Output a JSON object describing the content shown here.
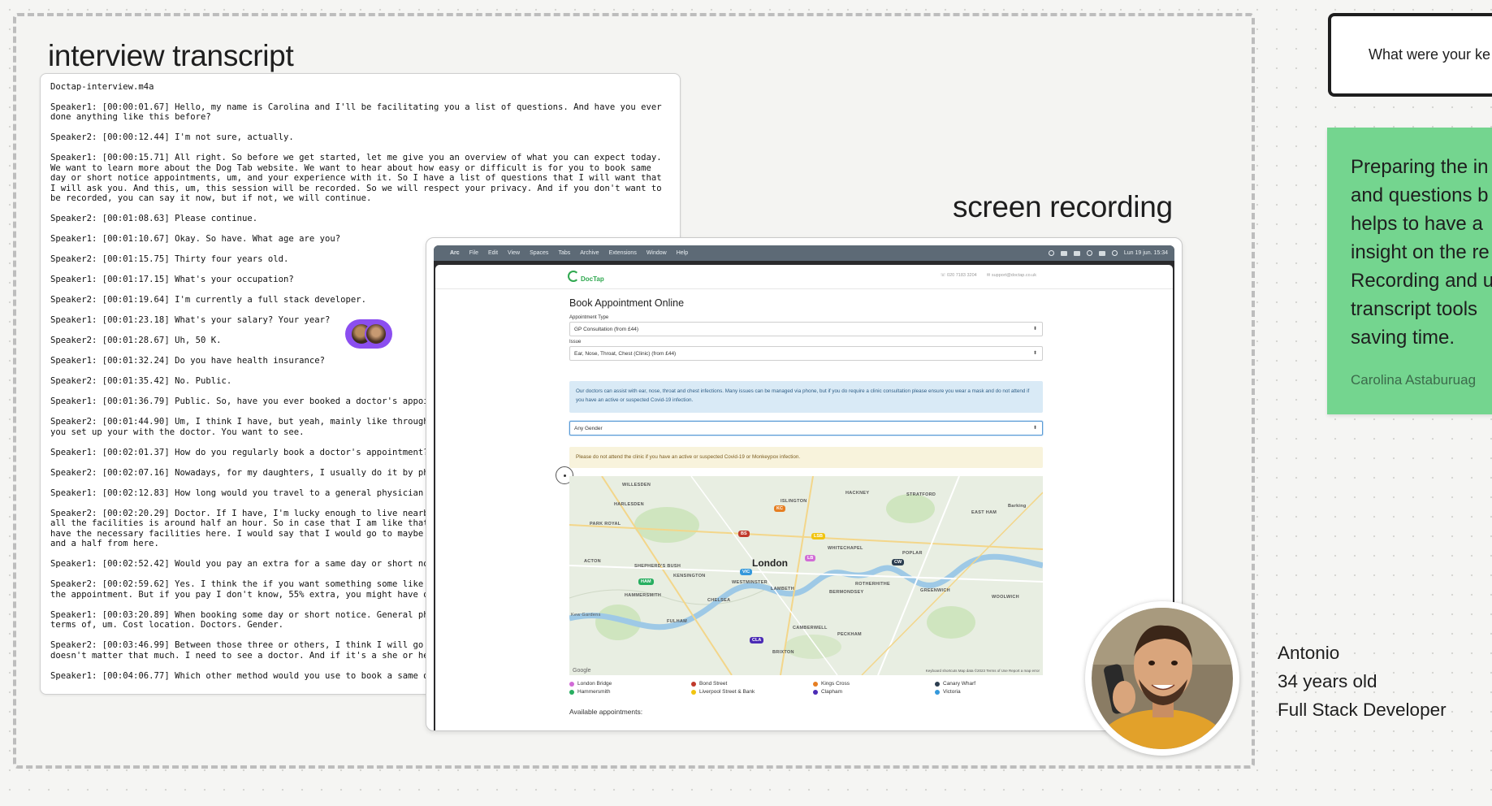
{
  "canvas": {
    "transcript_heading": "interview transcript",
    "recording_heading": "screen recording"
  },
  "transcript": {
    "filename": "Doctap-interview.m4a",
    "lines": [
      "Speaker1: [00:00:01.67] Hello, my name is Carolina and I'll be facilitating you a list of questions. And have you ever done anything like this before?",
      "Speaker2: [00:00:12.44] I'm not sure, actually.",
      "Speaker1: [00:00:15.71] All right. So before we get started, let me give you an overview of what you can expect today. We want to learn more about the Dog Tab website. We want to hear about how easy or difficult is for you to book same day or short notice appointments, um, and your experience with it. So I have a list of questions that I will want that I will ask you. And this, um, this session will be recorded. So we will respect your privacy. And if you don't want to be recorded, you can say it now, but if not, we will continue.",
      "Speaker2: [00:01:08.63] Please continue.",
      "Speaker1: [00:01:10.67] Okay. So have. What age are you?",
      "Speaker2: [00:01:15.75] Thirty four years old.",
      "Speaker1: [00:01:17.15] What's your occupation?",
      "Speaker2: [00:01:19.64] I'm currently a full stack developer.",
      "Speaker1: [00:01:23.18] What's your salary? Your year?",
      "Speaker2: [00:01:28.67] Uh, 50 K.",
      "Speaker1: [00:01:32.24] Do you have health insurance?",
      "Speaker2: [00:01:35.42] No. Public.",
      "Speaker1: [00:01:36.79] Public. So, have you ever booked a doctor's appoi",
      "Speaker2: [00:01:44.90] Um, I think I have, but yeah, mainly like through\nyou set up your with the doctor. You want to see.",
      "Speaker1: [00:02:01.37] How do you regularly book a doctor's appointment?",
      "Speaker2: [00:02:07.16] Nowadays, for my daughters, I usually do it by ph",
      "Speaker1: [00:02:12.83] How long would you travel to a general physician'",
      "Speaker2: [00:02:20.29] Doctor. If I have, I'm lucky enough to live nearb\nall the facilities is around half an hour. So in case that I am like that\nhave the necessary facilities here. I would say that I would go to maybe\nand a half from here.",
      "Speaker1: [00:02:52.42] Would you pay an extra for a same day or short no",
      "Speaker2: [00:02:59.62] Yes. I think the if you want something some like\nthe appointment. But if you pay I don't know, 55% extra, you might have o",
      "Speaker1: [00:03:20.89] When booking some day or short notice. General ph\nterms of, um. Cost location. Doctors. Gender.",
      "Speaker2: [00:03:46.99] Between those three or others, I think I will go\ndoesn't matter that much. I need to see a doctor. And if it's a she or he",
      "Speaker1: [00:04:06.77] Which other method would you use to book a same d"
    ]
  },
  "menubar": {
    "app": "Arc",
    "items": [
      "File",
      "Edit",
      "View",
      "Spaces",
      "Tabs",
      "Archive",
      "Extensions",
      "Window",
      "Help"
    ],
    "clock": "Lun 19 jun.  15:34"
  },
  "site": {
    "logo": "DocTap",
    "phone": "020 7183 3204",
    "email": "support@doctap.co.uk",
    "title": "Book Appointment Online",
    "appointment_type_label": "Appointment Type",
    "appointment_type_value": "GP Consultation (from £44)",
    "issue_label": "Issue",
    "issue_value": "Ear, Nose, Throat, Chest (Clinic) (from £44)",
    "info": "Our doctors can assist with ear, nose, throat and chest infections. Many issues can be managed via phone, but if you do require a clinic consultation please ensure you wear a mask and do not attend if you have an active or suspected Covid-19 infection.",
    "gender_value": "Any Gender",
    "warning": "Please do not attend the clinic if you have an active or suspected Covid-19 or Monkeypox infection.",
    "available": "Available appointments:"
  },
  "map": {
    "city": "London",
    "places": [
      "WILLESDEN",
      "HARLESDEN",
      "ISLINGTON",
      "HACKNEY",
      "STRATFORD",
      "EAST HAM",
      "Barking",
      "PARK ROYAL",
      "ACTON",
      "SHEPHERD'S BUSH",
      "KENSINGTON",
      "WESTMINSTER",
      "HAMMERSMITH",
      "CHELSEA",
      "FULHAM",
      "LAMBETH",
      "BERMONDSEY",
      "WHITECHAPEL",
      "POPLAR",
      "ROTHERHITHE",
      "GREENWICH",
      "WOOLWICH",
      "CAMBERWELL",
      "PECKHAM",
      "BRIXTON",
      "Kew Gardens"
    ],
    "markers": [
      {
        "code": "KC",
        "color": "#e67e22"
      },
      {
        "code": "BS",
        "color": "#c0392b"
      },
      {
        "code": "LSB",
        "color": "#f1c40f"
      },
      {
        "code": "LB",
        "color": "#d16bd6"
      },
      {
        "code": "CW",
        "color": "#2c3e50"
      },
      {
        "code": "HAM",
        "color": "#27ae60"
      },
      {
        "code": "VIC",
        "color": "#3498db"
      },
      {
        "code": "CLA",
        "color": "#4b2bb5"
      }
    ],
    "google": "Google",
    "attribution": "Keyboard shortcuts   Map data ©2023   Terms of Use   Report a map error"
  },
  "legend": [
    {
      "label": "London Bridge",
      "color": "#d16bd6"
    },
    {
      "label": "Bond Street",
      "color": "#c0392b"
    },
    {
      "label": "Kings Cross",
      "color": "#e67e22"
    },
    {
      "label": "Canary Wharf",
      "color": "#2c3e50"
    },
    {
      "label": "Hammersmith",
      "color": "#27ae60"
    },
    {
      "label": "Liverpool Street & Bank",
      "color": "#f1c40f"
    },
    {
      "label": "Clapham",
      "color": "#4b2bb5"
    },
    {
      "label": "Victoria",
      "color": "#3498db"
    }
  ],
  "persona": {
    "name": "Antonio",
    "age": "34 years old",
    "role": "Full Stack Developer"
  },
  "question_card": {
    "text": "What were your ke"
  },
  "note_card": {
    "lines": [
      "Preparing the in",
      "and questions b",
      "helps to have a",
      "insight on the re",
      "Recording and u",
      "transcript tools",
      "saving time."
    ],
    "author": "Carolina Astaburuag"
  }
}
